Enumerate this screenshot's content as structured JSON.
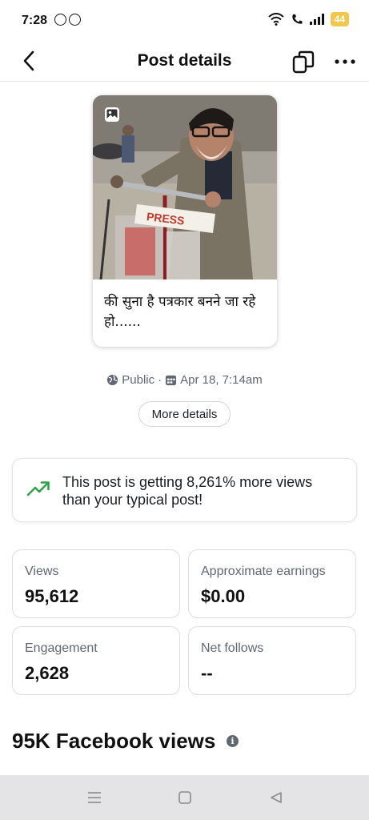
{
  "status_bar": {
    "time": "7:28",
    "battery": "44"
  },
  "header": {
    "title": "Post details",
    "back_icon": "chevron-left-icon",
    "copy_icon": "copy-icon",
    "more_icon": "more-horizontal-icon"
  },
  "post": {
    "image_badge_icon": "image-icon",
    "caption": "की सुना है पत्रकार बनने जा रहे हो......"
  },
  "meta": {
    "audience": "Public",
    "separator": "·",
    "date": "Apr 18, 7:14am",
    "more_details_label": "More details"
  },
  "insight": {
    "icon": "trending-up-icon",
    "text": "This post is getting 8,261% more views than your typical post!",
    "accent": "#31a24c"
  },
  "stats": {
    "views": {
      "label": "Views",
      "value": "95,612"
    },
    "earnings": {
      "label": "Approximate earnings",
      "value": "$0.00"
    },
    "engagement": {
      "label": "Engagement",
      "value": "2,628"
    },
    "follows": {
      "label": "Net follows",
      "value": "--"
    }
  },
  "section": {
    "title": "95K Facebook views",
    "info_icon": "info-icon"
  },
  "bottom_nav": {
    "menu_icon": "menu-icon",
    "home_icon": "square-home-icon",
    "back_icon": "triangle-back-icon"
  }
}
